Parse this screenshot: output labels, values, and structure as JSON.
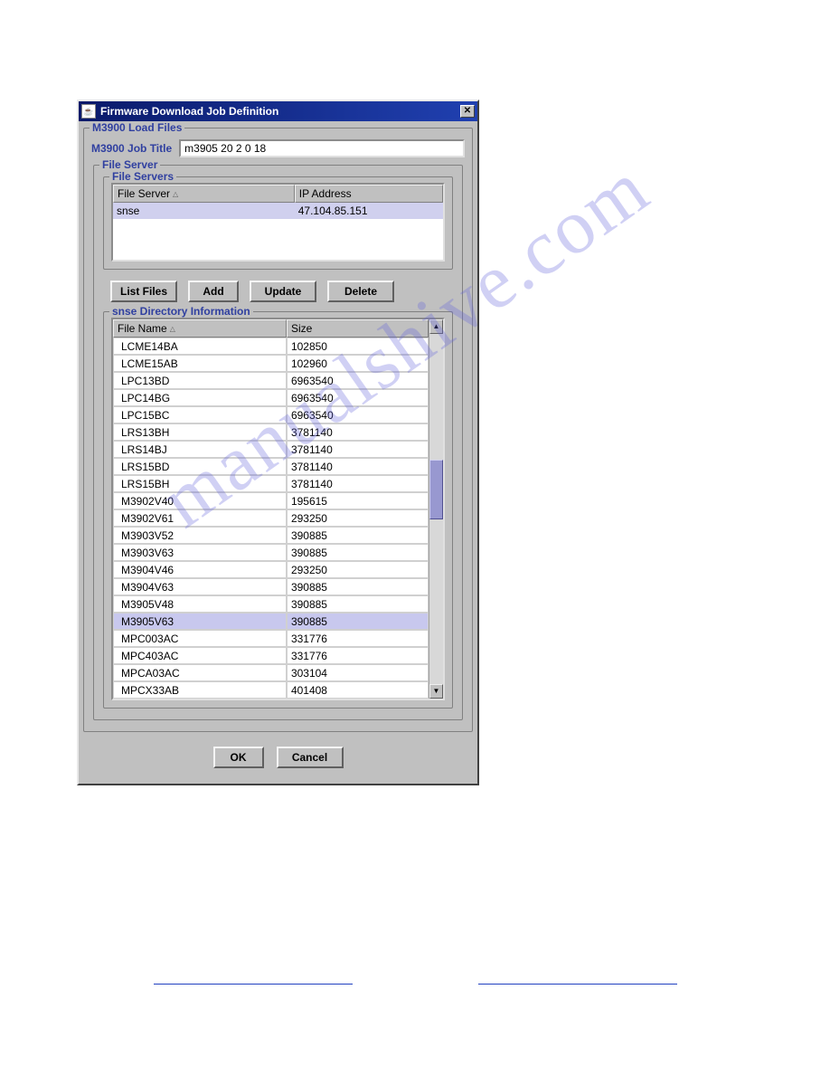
{
  "window": {
    "title": "Firmware Download Job Definition"
  },
  "groups": {
    "load_files_legend": "M3900 Load Files",
    "file_server_legend": "File Server",
    "file_servers_legend": "File Servers",
    "dir_info_legend": "snse  Directory Information"
  },
  "job_title": {
    "label": "M3900 Job Title",
    "value": "m3905 20 2 0 18"
  },
  "server_table": {
    "columns": {
      "server": "File Server",
      "ip": "IP Address"
    },
    "rows": [
      {
        "server": "snse",
        "ip": "47.104.85.151"
      }
    ]
  },
  "buttons": {
    "list_files": "List Files",
    "add": "Add",
    "update": "Update",
    "delete": "Delete",
    "ok": "OK",
    "cancel": "Cancel"
  },
  "file_table": {
    "columns": {
      "name": "File Name",
      "size": "Size"
    },
    "selected_index": 16,
    "rows": [
      {
        "name": "LCME14BA",
        "size": "102850"
      },
      {
        "name": "LCME15AB",
        "size": "102960"
      },
      {
        "name": "LPC13BD",
        "size": "6963540"
      },
      {
        "name": "LPC14BG",
        "size": "6963540"
      },
      {
        "name": "LPC15BC",
        "size": "6963540"
      },
      {
        "name": "LRS13BH",
        "size": "3781140"
      },
      {
        "name": "LRS14BJ",
        "size": "3781140"
      },
      {
        "name": "LRS15BD",
        "size": "3781140"
      },
      {
        "name": "LRS15BH",
        "size": "3781140"
      },
      {
        "name": "M3902V40",
        "size": "195615"
      },
      {
        "name": "M3902V61",
        "size": "293250"
      },
      {
        "name": "M3903V52",
        "size": "390885"
      },
      {
        "name": "M3903V63",
        "size": "390885"
      },
      {
        "name": "M3904V46",
        "size": "293250"
      },
      {
        "name": "M3904V63",
        "size": "390885"
      },
      {
        "name": "M3905V48",
        "size": "390885"
      },
      {
        "name": "M3905V63",
        "size": "390885"
      },
      {
        "name": "MPC003AC",
        "size": "331776"
      },
      {
        "name": "MPC403AC",
        "size": "331776"
      },
      {
        "name": "MPCA03AC",
        "size": "303104"
      },
      {
        "name": "MPCX33AB",
        "size": "401408"
      }
    ]
  },
  "watermark": "manualshive.com"
}
